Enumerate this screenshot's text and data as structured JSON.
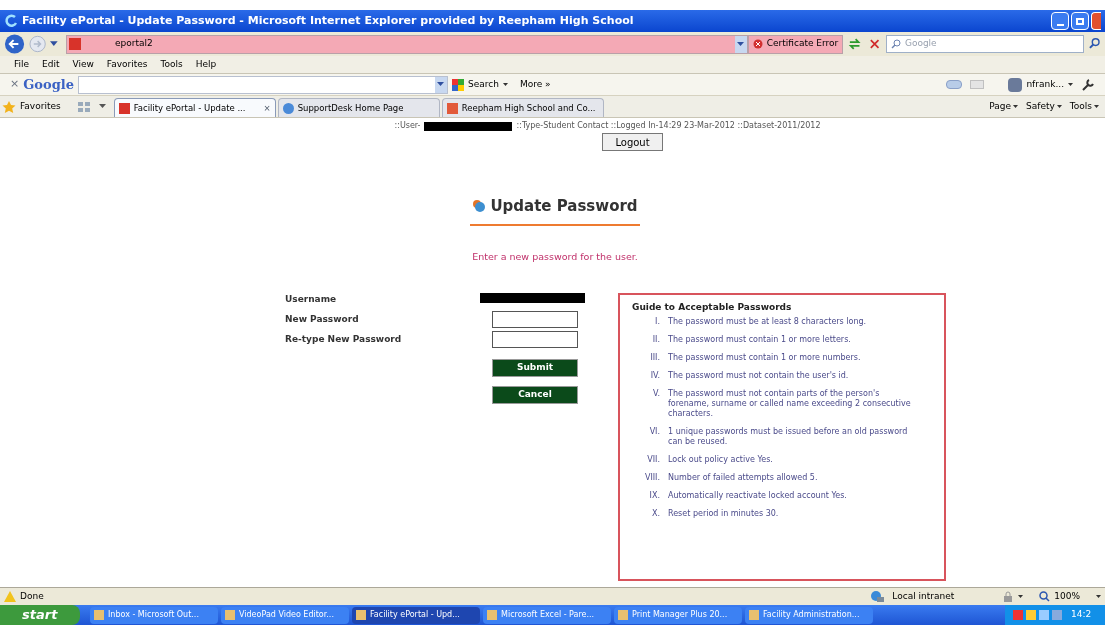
{
  "window": {
    "title": "Facility ePortal - Update Password - Microsoft Internet Explorer provided by Reepham High School"
  },
  "address_bar": {
    "url": "eportal2",
    "certificate": "Certificate Error",
    "search_placeholder": "Google"
  },
  "menu": [
    "File",
    "Edit",
    "View",
    "Favorites",
    "Tools",
    "Help"
  ],
  "google_toolbar": {
    "close": "×",
    "logo": "Google",
    "search": "Search",
    "more": "More »",
    "user": "nfrank..."
  },
  "favorites_bar": {
    "label": "Favorites",
    "tabs": [
      {
        "label": "Facility ePortal - Update ...",
        "selected": true,
        "close": "×"
      },
      {
        "label": "SupportDesk Home Page",
        "selected": false
      },
      {
        "label": "Reepham High School and Co...",
        "selected": false
      }
    ],
    "commands": [
      "Page",
      "Safety",
      "Tools"
    ]
  },
  "session": {
    "user_label": "::User-",
    "info": "::Type-Student Contact ::Logged In-14:29 23-Mar-2012 ::Dataset-2011/2012",
    "logout": "Logout"
  },
  "page": {
    "heading": "Update Password",
    "message": "Enter a new password for the user."
  },
  "form": {
    "fields": [
      {
        "label": "Username",
        "kind": "redacted"
      },
      {
        "label": "New Password",
        "kind": "input"
      },
      {
        "label": "Re-type New Password",
        "kind": "input"
      }
    ],
    "buttons": [
      "Submit",
      "Cancel"
    ]
  },
  "guide": {
    "title": "Guide to Acceptable Passwords",
    "items": [
      {
        "number": "I.",
        "text": "The password must be at least 8 characters long."
      },
      {
        "number": "II.",
        "text": "The password must contain 1 or more letters."
      },
      {
        "number": "III.",
        "text": "The password must contain 1 or more numbers."
      },
      {
        "number": "IV.",
        "text": "The password must not contain the user's id."
      },
      {
        "number": "V.",
        "text": "The password must not contain parts of the person's forename, surname or called name exceeding 2 consecutive characters."
      },
      {
        "number": "VI.",
        "text": "1 unique passwords must be issued before an old password can be reused."
      },
      {
        "number": "VII.",
        "text": "Lock out policy active Yes."
      },
      {
        "number": "VIII.",
        "text": "Number of failed attempts allowed 5."
      },
      {
        "number": "IX.",
        "text": "Automatically reactivate locked account Yes."
      },
      {
        "number": "X.",
        "text": "Reset period in minutes 30."
      }
    ]
  },
  "status_bar": {
    "status": "Done",
    "zone": "Local intranet",
    "zoom": "100%"
  },
  "taskbar": {
    "start": "start",
    "items": [
      {
        "label": "Inbox - Microsoft Out...",
        "selected": false
      },
      {
        "label": "VideoPad Video Editor...",
        "selected": false
      },
      {
        "label": "Facility ePortal - Upd...",
        "selected": true
      },
      {
        "label": "Microsoft Excel - Pare...",
        "selected": false
      },
      {
        "label": "Print Manager Plus 20...",
        "selected": false
      },
      {
        "label": "Facility Administration...",
        "selected": false
      }
    ],
    "clock": "14:2"
  }
}
